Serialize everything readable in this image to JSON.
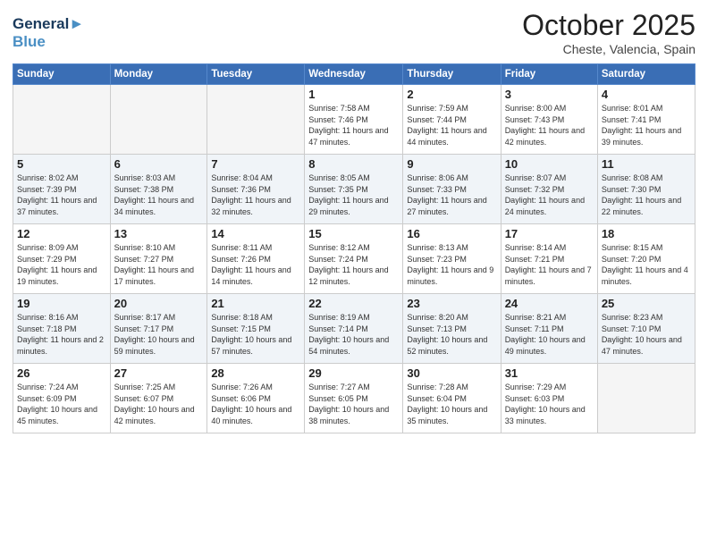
{
  "header": {
    "logo_line1": "General",
    "logo_line2": "Blue",
    "month": "October 2025",
    "location": "Cheste, Valencia, Spain"
  },
  "weekdays": [
    "Sunday",
    "Monday",
    "Tuesday",
    "Wednesday",
    "Thursday",
    "Friday",
    "Saturday"
  ],
  "weeks": [
    [
      {
        "day": "",
        "sunrise": "",
        "sunset": "",
        "daylight": ""
      },
      {
        "day": "",
        "sunrise": "",
        "sunset": "",
        "daylight": ""
      },
      {
        "day": "",
        "sunrise": "",
        "sunset": "",
        "daylight": ""
      },
      {
        "day": "1",
        "sunrise": "Sunrise: 7:58 AM",
        "sunset": "Sunset: 7:46 PM",
        "daylight": "Daylight: 11 hours and 47 minutes."
      },
      {
        "day": "2",
        "sunrise": "Sunrise: 7:59 AM",
        "sunset": "Sunset: 7:44 PM",
        "daylight": "Daylight: 11 hours and 44 minutes."
      },
      {
        "day": "3",
        "sunrise": "Sunrise: 8:00 AM",
        "sunset": "Sunset: 7:43 PM",
        "daylight": "Daylight: 11 hours and 42 minutes."
      },
      {
        "day": "4",
        "sunrise": "Sunrise: 8:01 AM",
        "sunset": "Sunset: 7:41 PM",
        "daylight": "Daylight: 11 hours and 39 minutes."
      }
    ],
    [
      {
        "day": "5",
        "sunrise": "Sunrise: 8:02 AM",
        "sunset": "Sunset: 7:39 PM",
        "daylight": "Daylight: 11 hours and 37 minutes."
      },
      {
        "day": "6",
        "sunrise": "Sunrise: 8:03 AM",
        "sunset": "Sunset: 7:38 PM",
        "daylight": "Daylight: 11 hours and 34 minutes."
      },
      {
        "day": "7",
        "sunrise": "Sunrise: 8:04 AM",
        "sunset": "Sunset: 7:36 PM",
        "daylight": "Daylight: 11 hours and 32 minutes."
      },
      {
        "day": "8",
        "sunrise": "Sunrise: 8:05 AM",
        "sunset": "Sunset: 7:35 PM",
        "daylight": "Daylight: 11 hours and 29 minutes."
      },
      {
        "day": "9",
        "sunrise": "Sunrise: 8:06 AM",
        "sunset": "Sunset: 7:33 PM",
        "daylight": "Daylight: 11 hours and 27 minutes."
      },
      {
        "day": "10",
        "sunrise": "Sunrise: 8:07 AM",
        "sunset": "Sunset: 7:32 PM",
        "daylight": "Daylight: 11 hours and 24 minutes."
      },
      {
        "day": "11",
        "sunrise": "Sunrise: 8:08 AM",
        "sunset": "Sunset: 7:30 PM",
        "daylight": "Daylight: 11 hours and 22 minutes."
      }
    ],
    [
      {
        "day": "12",
        "sunrise": "Sunrise: 8:09 AM",
        "sunset": "Sunset: 7:29 PM",
        "daylight": "Daylight: 11 hours and 19 minutes."
      },
      {
        "day": "13",
        "sunrise": "Sunrise: 8:10 AM",
        "sunset": "Sunset: 7:27 PM",
        "daylight": "Daylight: 11 hours and 17 minutes."
      },
      {
        "day": "14",
        "sunrise": "Sunrise: 8:11 AM",
        "sunset": "Sunset: 7:26 PM",
        "daylight": "Daylight: 11 hours and 14 minutes."
      },
      {
        "day": "15",
        "sunrise": "Sunrise: 8:12 AM",
        "sunset": "Sunset: 7:24 PM",
        "daylight": "Daylight: 11 hours and 12 minutes."
      },
      {
        "day": "16",
        "sunrise": "Sunrise: 8:13 AM",
        "sunset": "Sunset: 7:23 PM",
        "daylight": "Daylight: 11 hours and 9 minutes."
      },
      {
        "day": "17",
        "sunrise": "Sunrise: 8:14 AM",
        "sunset": "Sunset: 7:21 PM",
        "daylight": "Daylight: 11 hours and 7 minutes."
      },
      {
        "day": "18",
        "sunrise": "Sunrise: 8:15 AM",
        "sunset": "Sunset: 7:20 PM",
        "daylight": "Daylight: 11 hours and 4 minutes."
      }
    ],
    [
      {
        "day": "19",
        "sunrise": "Sunrise: 8:16 AM",
        "sunset": "Sunset: 7:18 PM",
        "daylight": "Daylight: 11 hours and 2 minutes."
      },
      {
        "day": "20",
        "sunrise": "Sunrise: 8:17 AM",
        "sunset": "Sunset: 7:17 PM",
        "daylight": "Daylight: 10 hours and 59 minutes."
      },
      {
        "day": "21",
        "sunrise": "Sunrise: 8:18 AM",
        "sunset": "Sunset: 7:15 PM",
        "daylight": "Daylight: 10 hours and 57 minutes."
      },
      {
        "day": "22",
        "sunrise": "Sunrise: 8:19 AM",
        "sunset": "Sunset: 7:14 PM",
        "daylight": "Daylight: 10 hours and 54 minutes."
      },
      {
        "day": "23",
        "sunrise": "Sunrise: 8:20 AM",
        "sunset": "Sunset: 7:13 PM",
        "daylight": "Daylight: 10 hours and 52 minutes."
      },
      {
        "day": "24",
        "sunrise": "Sunrise: 8:21 AM",
        "sunset": "Sunset: 7:11 PM",
        "daylight": "Daylight: 10 hours and 49 minutes."
      },
      {
        "day": "25",
        "sunrise": "Sunrise: 8:23 AM",
        "sunset": "Sunset: 7:10 PM",
        "daylight": "Daylight: 10 hours and 47 minutes."
      }
    ],
    [
      {
        "day": "26",
        "sunrise": "Sunrise: 7:24 AM",
        "sunset": "Sunset: 6:09 PM",
        "daylight": "Daylight: 10 hours and 45 minutes."
      },
      {
        "day": "27",
        "sunrise": "Sunrise: 7:25 AM",
        "sunset": "Sunset: 6:07 PM",
        "daylight": "Daylight: 10 hours and 42 minutes."
      },
      {
        "day": "28",
        "sunrise": "Sunrise: 7:26 AM",
        "sunset": "Sunset: 6:06 PM",
        "daylight": "Daylight: 10 hours and 40 minutes."
      },
      {
        "day": "29",
        "sunrise": "Sunrise: 7:27 AM",
        "sunset": "Sunset: 6:05 PM",
        "daylight": "Daylight: 10 hours and 38 minutes."
      },
      {
        "day": "30",
        "sunrise": "Sunrise: 7:28 AM",
        "sunset": "Sunset: 6:04 PM",
        "daylight": "Daylight: 10 hours and 35 minutes."
      },
      {
        "day": "31",
        "sunrise": "Sunrise: 7:29 AM",
        "sunset": "Sunset: 6:03 PM",
        "daylight": "Daylight: 10 hours and 33 minutes."
      },
      {
        "day": "",
        "sunrise": "",
        "sunset": "",
        "daylight": ""
      }
    ]
  ]
}
